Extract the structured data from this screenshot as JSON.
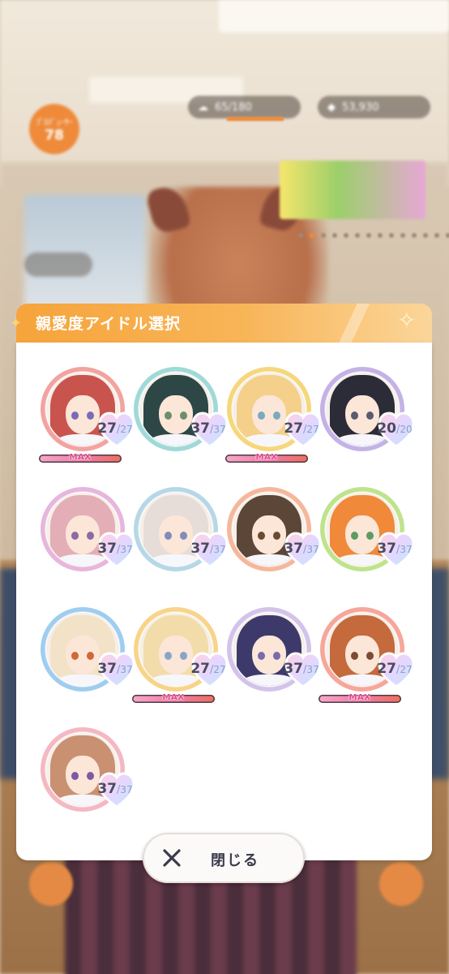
{
  "hud": {
    "level_small": "ﾌﾟﾛﾃﾞｭｰｻｰ",
    "level_value": "78",
    "stamina": "65/180",
    "gems": "53,930"
  },
  "modal": {
    "title": "親愛度アイドル選択",
    "close_label": "閉じる"
  },
  "idols": [
    {
      "current": "27",
      "max": "27",
      "maxed": true,
      "ring": "#f2a3a0",
      "hair": "#c9544e",
      "eye": "#7b6bb5"
    },
    {
      "current": "37",
      "max": "37",
      "maxed": false,
      "ring": "#9fd9d8",
      "hair": "#2d4747",
      "eye": "#6b8f6a"
    },
    {
      "current": "27",
      "max": "27",
      "maxed": true,
      "ring": "#f5d77c",
      "hair": "#f4d08a",
      "eye": "#7aa9c0"
    },
    {
      "current": "20",
      "max": "20",
      "maxed": false,
      "ring": "#c4b2e6",
      "hair": "#2c2c38",
      "eye": "#5a5a70"
    },
    {
      "current": "37",
      "max": "37",
      "maxed": false,
      "ring": "#e7b6dc",
      "hair": "#e4aeb6",
      "eye": "#8c6aa5"
    },
    {
      "current": "37",
      "max": "37",
      "maxed": false,
      "ring": "#b6d7e6",
      "hair": "#e6ddd8",
      "eye": "#7f8db8"
    },
    {
      "current": "37",
      "max": "37",
      "maxed": false,
      "ring": "#f5b79b",
      "hair": "#5b4637",
      "eye": "#6a4a30"
    },
    {
      "current": "37",
      "max": "37",
      "maxed": false,
      "ring": "#bfe38d",
      "hair": "#f0893a",
      "eye": "#5c9c62"
    },
    {
      "current": "37",
      "max": "37",
      "maxed": false,
      "ring": "#9fcdef",
      "hair": "#f2e2c8",
      "eye": "#d0683a"
    },
    {
      "current": "27",
      "max": "27",
      "maxed": true,
      "ring": "#f7d489",
      "hair": "#f2dcaa",
      "eye": "#8aa4c9"
    },
    {
      "current": "37",
      "max": "37",
      "maxed": false,
      "ring": "#d3c3ea",
      "hair": "#3d3a6b",
      "eye": "#7a6ba9"
    },
    {
      "current": "27",
      "max": "27",
      "maxed": true,
      "ring": "#f6a69a",
      "hair": "#c46a3c",
      "eye": "#7d4a35"
    },
    {
      "current": "37",
      "max": "37",
      "maxed": false,
      "ring": "#f4b8c2",
      "hair": "#c99072",
      "eye": "#7d5aa3"
    }
  ],
  "max_badge_label": "MAX"
}
